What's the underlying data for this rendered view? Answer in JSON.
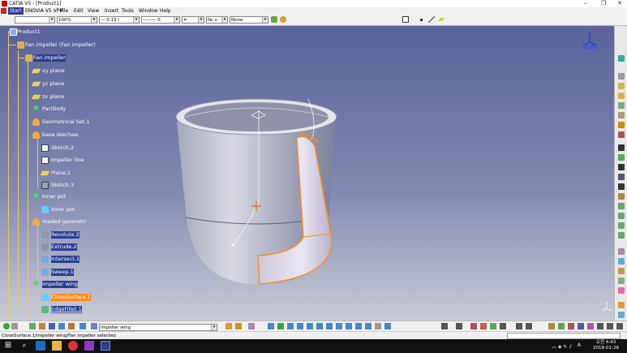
{
  "window": {
    "title": "CATIA V5 - [Product1]",
    "minimize": "–",
    "restore": "❐",
    "close": "✕"
  },
  "menu": [
    "Start",
    "ENOVIA V5 VPM",
    "File",
    "Edit",
    "View",
    "Insert",
    "Tools",
    "Window",
    "Help"
  ],
  "toolbar": {
    "zoom": "100%",
    "line_thickness": "— 0.13 l",
    "line_type": "——— 0",
    "point_style": "✕",
    "layer": "Nc s",
    "material": "None"
  },
  "tree": [
    {
      "label": "Product1",
      "icon": "product-icon"
    },
    {
      "label": "Fan impeller (Fan impeller)",
      "icon": "part-icon"
    },
    {
      "label": "Fan impeller",
      "icon": "part-body-icon",
      "state": "selected"
    },
    {
      "label": "xy plane",
      "icon": "plane-icon"
    },
    {
      "label": "yz plane",
      "icon": "plane-icon"
    },
    {
      "label": "zx plane",
      "icon": "plane-icon"
    },
    {
      "label": "PartBody",
      "icon": "body-icon"
    },
    {
      "label": "Geometrical Set.1",
      "icon": "geometrical-set-icon"
    },
    {
      "label": "base skechee",
      "icon": "geometrical-set-icon"
    },
    {
      "label": "Sketch.2",
      "icon": "sketch-icon"
    },
    {
      "label": "impeller line",
      "icon": "sketch-icon"
    },
    {
      "label": "Plane.1",
      "icon": "plane-icon"
    },
    {
      "label": "Sketch.3",
      "icon": "sketch-icon"
    },
    {
      "label": "inner pot",
      "icon": "body-icon"
    },
    {
      "label": "inner pot",
      "icon": "surface-icon"
    },
    {
      "label": "maded geometri",
      "icon": "geometrical-set-icon"
    },
    {
      "label": "Revolute.2",
      "icon": "revolve-icon"
    },
    {
      "label": "Extrude.2",
      "icon": "extrude-icon"
    },
    {
      "label": "Intersect.1",
      "icon": "intersect-icon"
    },
    {
      "label": "Sweep.1",
      "icon": "sweep-icon"
    },
    {
      "label": "impeller wing",
      "icon": "body-icon"
    },
    {
      "label": "CloseSurface.1",
      "icon": "close-surface-icon",
      "state": "highlighted"
    },
    {
      "label": "EdgeFillet.1",
      "icon": "edge-fillet-icon"
    }
  ],
  "bottom_toolbar": {
    "selection_value": "impeller wing"
  },
  "status": {
    "text": "CloseSurface.1/impeller wing/Fan impeller selected"
  },
  "clock": {
    "time": "오전 4:43",
    "date": "2018-01-28",
    "lang": "A"
  },
  "colors": {
    "accent": "#ff8c1a",
    "selection": "#2a3f8f",
    "tree_line": "#f2c55f"
  }
}
